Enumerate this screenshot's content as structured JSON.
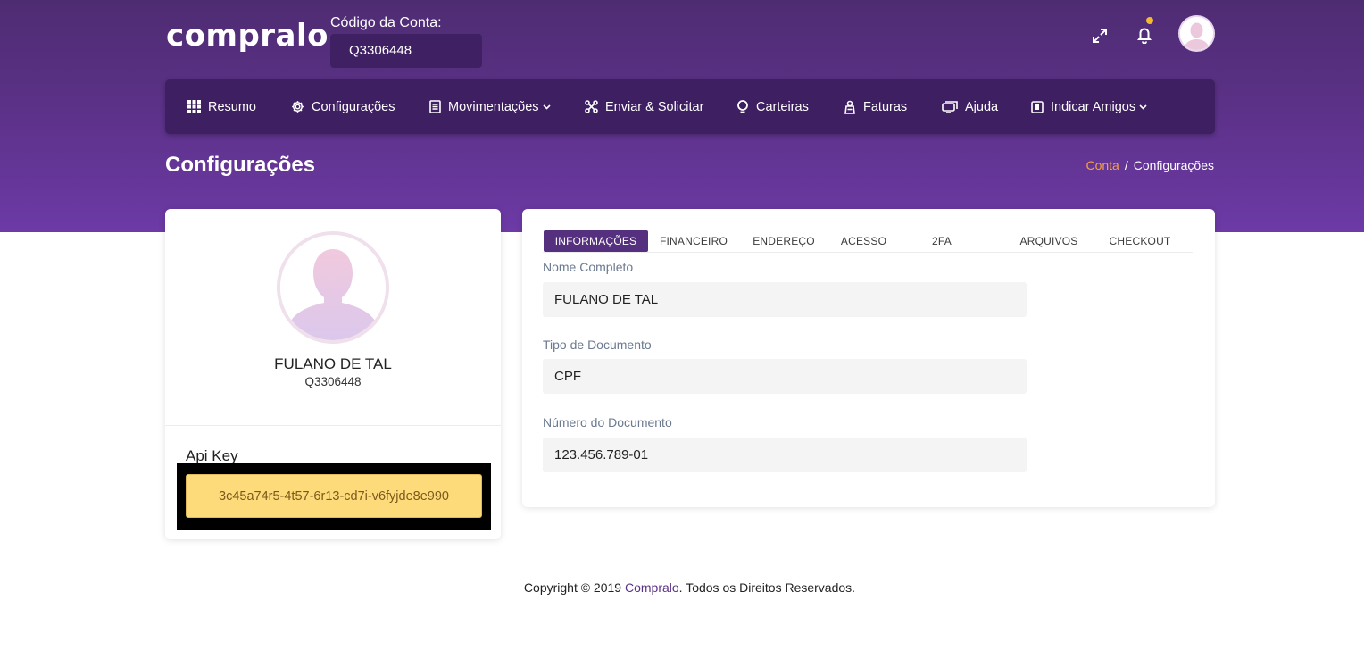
{
  "header": {
    "logo": "compralo",
    "account_label": "Código da Conta:",
    "account_code": "Q3306448",
    "icons": [
      "expand-icon",
      "bell-icon",
      "user-avatar"
    ]
  },
  "nav": [
    {
      "label": "Resumo",
      "icon": "grid-icon"
    },
    {
      "label": "Configurações",
      "icon": "gear-icon"
    },
    {
      "label": "Movimentações",
      "icon": "document-icon",
      "dropdown": true
    },
    {
      "label": "Enviar & Solicitar",
      "icon": "exchange-icon"
    },
    {
      "label": "Carteiras",
      "icon": "wallet-icon"
    },
    {
      "label": "Faturas",
      "icon": "invoice-icon"
    },
    {
      "label": "Ajuda",
      "icon": "help-icon"
    },
    {
      "label": "Indicar Amigos",
      "icon": "gift-icon",
      "dropdown": true
    }
  ],
  "page": {
    "title": "Configurações",
    "breadcrumb": {
      "link": "Conta",
      "separator": "/",
      "current": "Configurações"
    }
  },
  "profile": {
    "name": "FULANO DE TAL",
    "code": "Q3306448",
    "api_key_label": "Api Key",
    "api_key": "3c45a74r5-4t57-6r13-cd7i-v6fyjde8e990"
  },
  "tabs": [
    {
      "label": "INFORMAÇÕES",
      "active": true
    },
    {
      "label": "FINANCEIRO",
      "active": false
    },
    {
      "label": "ENDEREÇO",
      "active": false
    },
    {
      "label": "ACESSO",
      "active": false
    },
    {
      "label": "2FA",
      "active": false
    },
    {
      "label": "ARQUIVOS",
      "active": false
    },
    {
      "label": "CHECKOUT",
      "active": false
    }
  ],
  "fields": [
    {
      "label": "Nome Completo",
      "value": "FULANO DE TAL"
    },
    {
      "label": "Tipo de Documento",
      "value": "CPF"
    },
    {
      "label": "Número do Documento",
      "value": "123.456.789-01"
    }
  ],
  "footer": {
    "prefix": "Copyright © 2019 ",
    "brand": "Compralo",
    "suffix": ". Todos os Direitos Reservados."
  },
  "colors": {
    "header_gradient_top": "#4e2c72",
    "header_gradient_bottom": "#6d3aa6",
    "navbar": "#3e1f62",
    "active_tab": "#55307f",
    "breadcrumb_link": "#f5a04a",
    "api_key_bg": "#fedb7a",
    "notification_dot": "#f5b82e"
  }
}
